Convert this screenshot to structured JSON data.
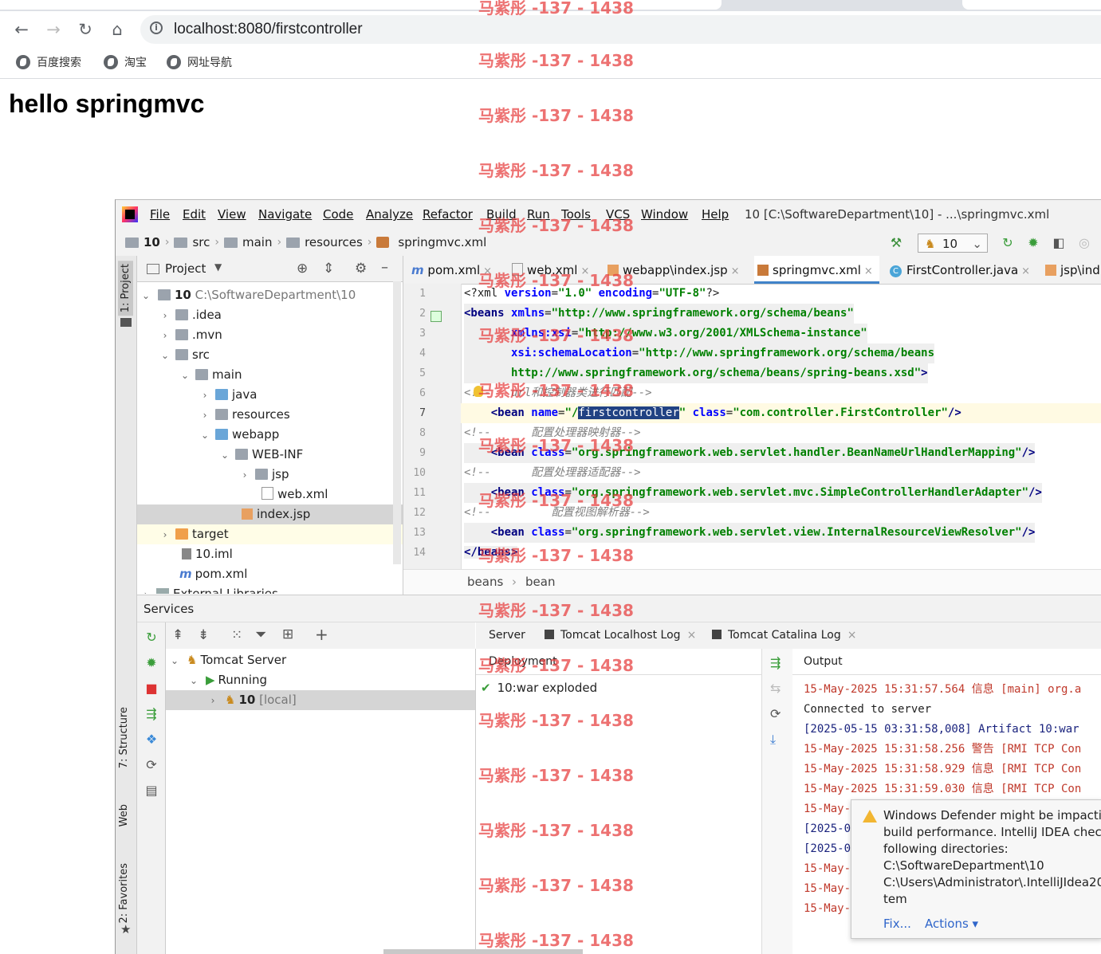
{
  "browser": {
    "url": "localhost:8080/firstcontroller",
    "bookmarks": [
      "百度搜索",
      "淘宝",
      "网址导航"
    ],
    "page_heading": "hello springmvc"
  },
  "ide": {
    "menus": [
      "File",
      "Edit",
      "View",
      "Navigate",
      "Code",
      "Analyze",
      "Refactor",
      "Build",
      "Run",
      "Tools",
      "VCS",
      "Window",
      "Help"
    ],
    "window_title": "10 [C:\\SoftwareDepartment\\10] - ...\\springmvc.xml",
    "breadcrumbs": [
      "10",
      "src",
      "main",
      "resources",
      "springmvc.xml"
    ],
    "run_config": "10",
    "left_tabs": [
      "1: Project",
      "7: Structure",
      "Web",
      "2: Favorites"
    ],
    "project_panel_title": "Project",
    "tree": [
      {
        "label": "10",
        "extra": "C:\\SoftwareDepartment\\10"
      },
      {
        "label": ".idea"
      },
      {
        "label": ".mvn"
      },
      {
        "label": "src"
      },
      {
        "label": "main"
      },
      {
        "label": "java"
      },
      {
        "label": "resources"
      },
      {
        "label": "webapp"
      },
      {
        "label": "WEB-INF"
      },
      {
        "label": "jsp"
      },
      {
        "label": "web.xml"
      },
      {
        "label": "index.jsp"
      },
      {
        "label": "target"
      },
      {
        "label": "10.iml"
      },
      {
        "label": "pom.xml"
      },
      {
        "label": "External Libraries"
      }
    ],
    "editor_tabs": [
      "pom.xml",
      "web.xml",
      "webapp\\index.jsp",
      "springmvc.xml",
      "FirstController.java",
      "jsp\\ind"
    ],
    "active_tab": "springmvc.xml",
    "line_numbers": [
      "1",
      "2",
      "3",
      "4",
      "5",
      "6",
      "7",
      "8",
      "9",
      "10",
      "11",
      "12",
      "13",
      "14"
    ],
    "code": {
      "l1_a": "<?xml ",
      "l1_b": "version",
      "l1_c": "=",
      "l1_d": "\"1.0\"",
      "l1_e": " encoding",
      "l1_f": "=",
      "l1_g": "\"UTF-8\"",
      "l1_h": "?>",
      "l2_a": "<beans ",
      "l2_b": "xmlns",
      "l2_c": "=",
      "l2_d": "\"http://www.springframework.org/schema/beans\"",
      "l3_a": "       xmlns:xsi",
      "l3_b": "=",
      "l3_c": "\"http://www.w3.org/2001/XMLSchema-instance\"",
      "l4_a": "       xsi:schemaLocation",
      "l4_b": "=",
      "l4_c": "\"http://www.springframework.org/schema/beans",
      "l5_a": "       http://www.springframework.org/schema/beans/spring-beans.xsd\"",
      "l5_b": ">",
      "l6": "<!--   url和控制器类进行匹配-->",
      "l7_a": "    <bean ",
      "l7_b": "name",
      "l7_c": "=",
      "l7_d": "\"/",
      "l7_e": "firstcontroller",
      "l7_f": "\"",
      "l7_g": " class",
      "l7_h": "=",
      "l7_i": "\"com.controller.FirstController\"",
      "l7_j": "/>",
      "l8": "<!--      配置处理器映射器-->",
      "l9_a": "    <bean ",
      "l9_b": "class",
      "l9_c": "=",
      "l9_d": "\"org.springframework.web.servlet.handler.BeanNameUrlHandlerMapping\"",
      "l9_e": "/>",
      "l10": "<!--      配置处理器适配器-->",
      "l11_a": "    <bean ",
      "l11_b": "class",
      "l11_c": "=",
      "l11_d": "\"org.springframework.web.servlet.mvc.SimpleControllerHandlerAdapter\"",
      "l11_e": "/>",
      "l12": "<!--         配置视图解析器-->",
      "l13_a": "    <bean ",
      "l13_b": "class",
      "l13_c": "=",
      "l13_d": "\"org.springframework.web.servlet.view.InternalResourceViewResolver\"",
      "l13_e": "/>",
      "l14": "</beans>"
    },
    "editor_breadcrumb": [
      "beans",
      "bean"
    ],
    "services": {
      "title": "Services",
      "tree": [
        {
          "label": "Tomcat Server"
        },
        {
          "label": "Running"
        },
        {
          "label": "10",
          "extra": "[local]"
        }
      ],
      "tabs": [
        "Server",
        "Tomcat Localhost Log",
        "Tomcat Catalina Log"
      ],
      "deployment_header": "Deployment",
      "deployment_item": "10:war exploded",
      "output_header": "Output",
      "output_lines": [
        "15-May-2025 15:31:57.564 信息 [main] org.a",
        "Connected to server",
        "[2025-05-15 03:31:58,008] Artifact 10:war",
        "15-May-2025 15:31:58.256 警告 [RMI TCP Con",
        "15-May-2025 15:31:58.929 信息 [RMI TCP Con",
        "15-May-2025 15:31:59.030 信息 [RMI TCP Con",
        "15-May-",
        "[2025-0",
        "[2025-0",
        "15-May-",
        "15-May-",
        "15-May-"
      ]
    },
    "notification": {
      "lines": [
        "Windows Defender might be impactin",
        "build performance. IntelliJ IDEA check",
        "following directories:",
        "C:\\SoftwareDepartment\\10",
        "C:\\Users\\Administrator\\.IntelliJIdea20",
        "tem"
      ],
      "fix_label": "Fix...",
      "actions_label": "Actions ▾"
    }
  },
  "watermark": "马紫彤 -137 - 1438",
  "colors": {
    "xml_tag": "#000080",
    "xml_attr": "#0000ff",
    "xml_value": "#008000",
    "comment": "#808080",
    "selection": "#214283"
  }
}
